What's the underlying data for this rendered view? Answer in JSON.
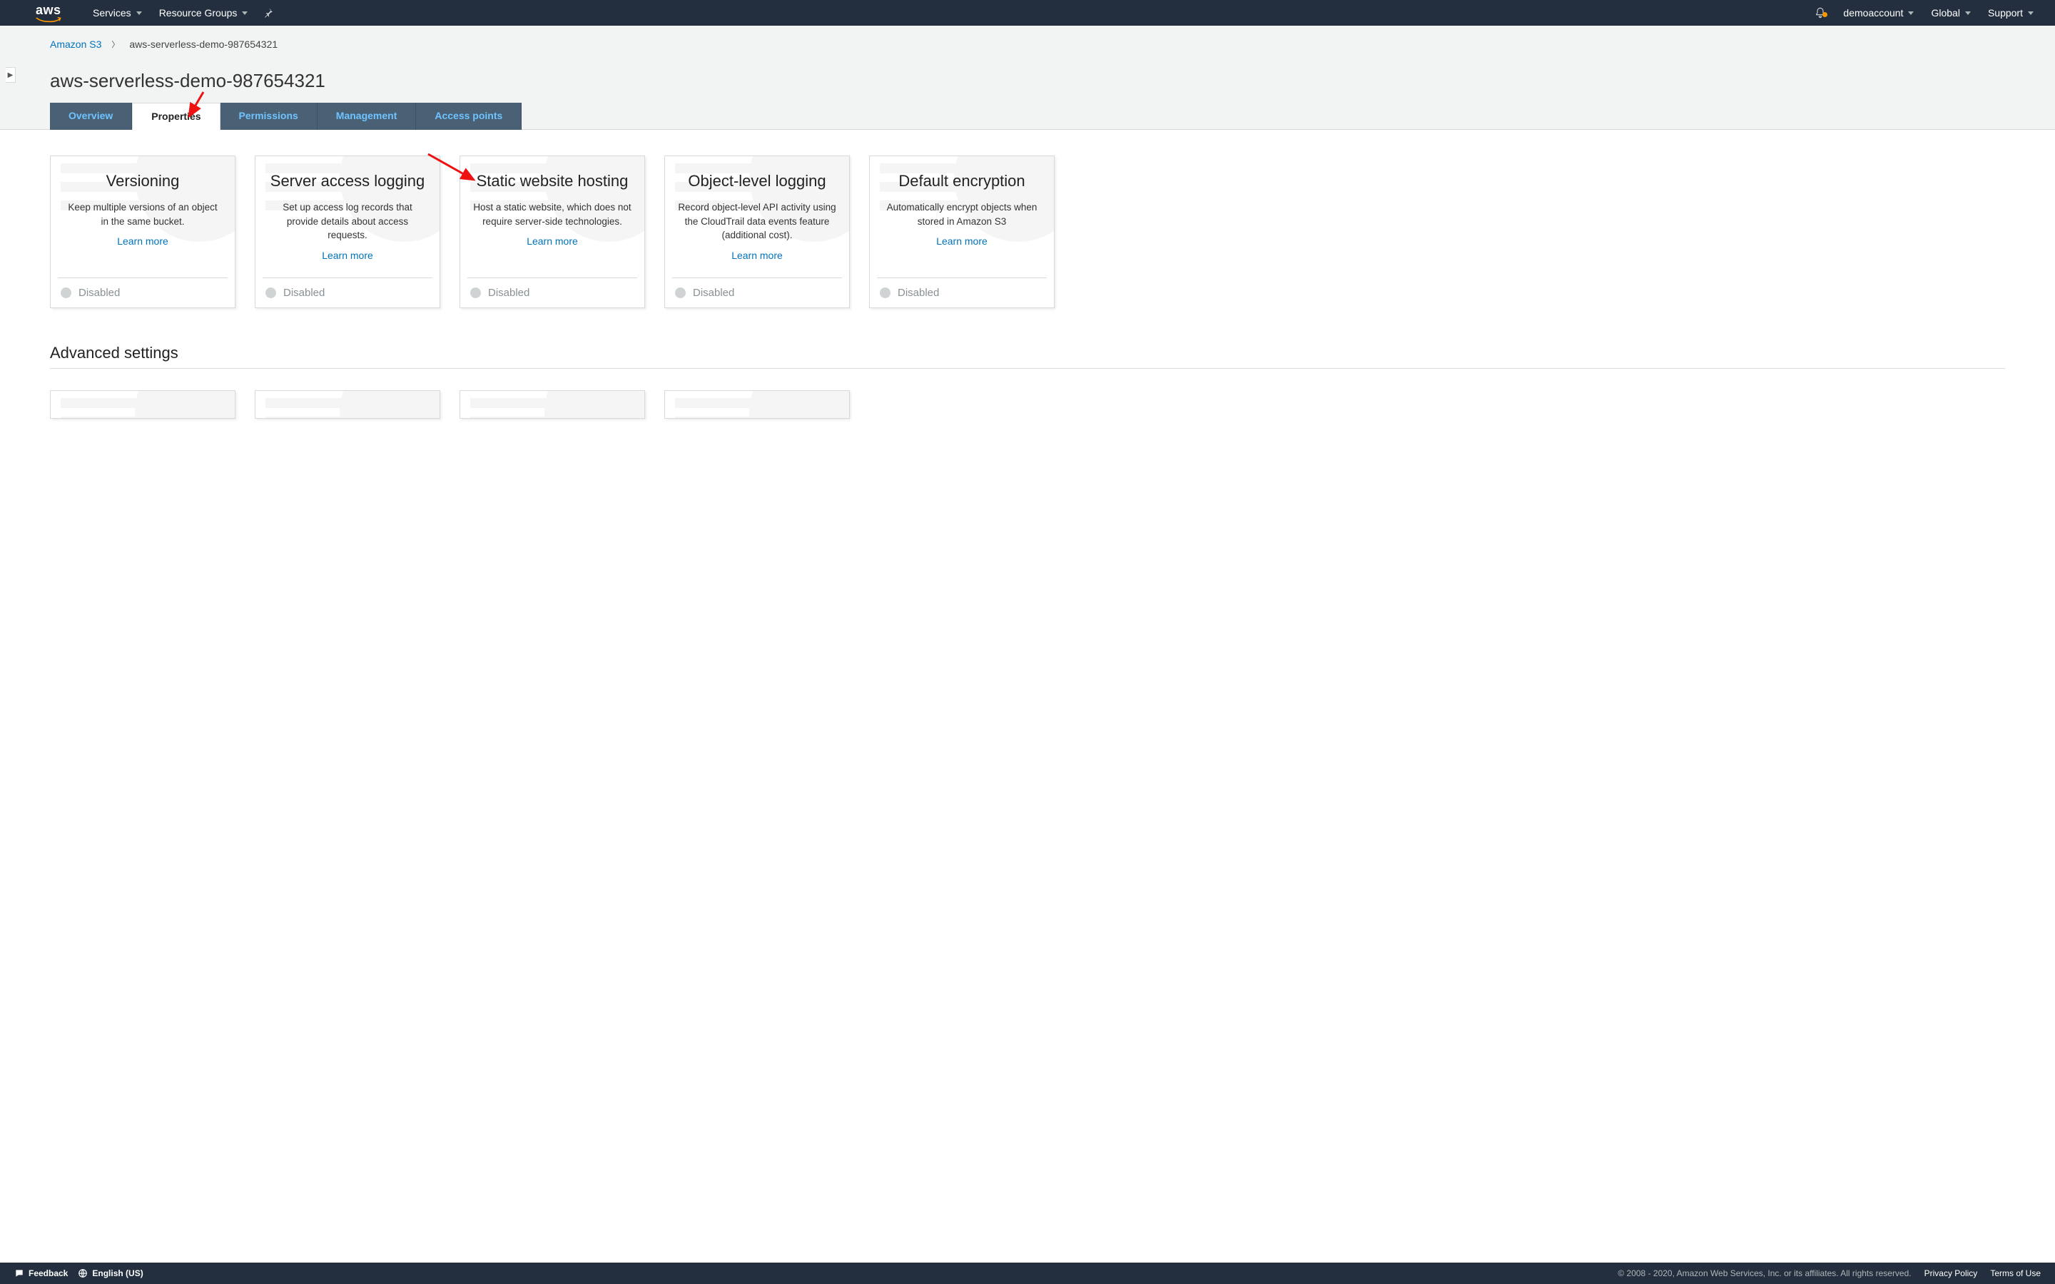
{
  "topbar": {
    "services": "Services",
    "resource_groups": "Resource Groups",
    "account": "demoaccount",
    "region": "Global",
    "support": "Support"
  },
  "breadcrumb": {
    "root": "Amazon S3",
    "current": "aws-serverless-demo-987654321"
  },
  "bucket_title": "aws-serverless-demo-987654321",
  "tabs": {
    "overview": "Overview",
    "properties": "Properties",
    "permissions": "Permissions",
    "management": "Management",
    "access_points": "Access points"
  },
  "tiles": [
    {
      "title": "Versioning",
      "desc": "Keep multiple versions of an object in the same bucket.",
      "learn": "Learn more",
      "status": "Disabled"
    },
    {
      "title": "Server access logging",
      "desc": "Set up access log records that provide details about access requests.",
      "learn": "Learn more",
      "status": "Disabled"
    },
    {
      "title": "Static website hosting",
      "desc": "Host a static website, which does not require server-side technologies.",
      "learn": "Learn more",
      "status": "Disabled"
    },
    {
      "title": "Object-level logging",
      "desc": "Record object-level API activity using the CloudTrail data events feature (additional cost).",
      "learn": "Learn more",
      "status": "Disabled"
    },
    {
      "title": "Default encryption",
      "desc": "Automatically encrypt objects when stored in Amazon S3",
      "learn": "Learn more",
      "status": "Disabled"
    }
  ],
  "advanced_title": "Advanced settings",
  "bottombar": {
    "feedback": "Feedback",
    "language": "English (US)",
    "legal": "© 2008 - 2020, Amazon Web Services, Inc. or its affiliates. All rights reserved.",
    "privacy": "Privacy Policy",
    "terms": "Terms of Use"
  }
}
